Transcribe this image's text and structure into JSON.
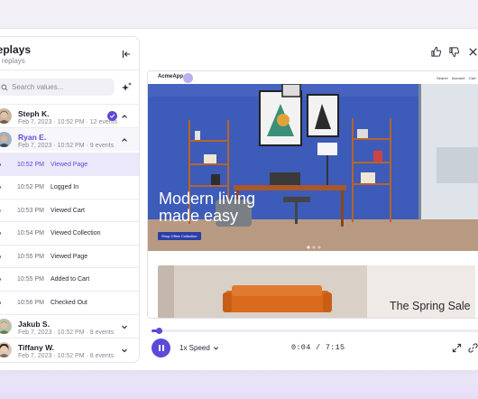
{
  "sidebar": {
    "title": "Replays",
    "subtitle": "replays",
    "search_placeholder": "Search values...",
    "users": [
      {
        "name": "Steph K.",
        "meta": "Feb 7, 2023 · 10:52 PM · 12 events",
        "expanded": true,
        "checked": true
      },
      {
        "name": "Ryan E.",
        "meta": "Feb 7, 2023 · 10:52 PM · 9 events",
        "expanded": true,
        "active": true
      },
      {
        "name": "Jakub S.",
        "meta": "Feb 7, 2023 · 10:52 PM · 8 events",
        "expanded": false
      },
      {
        "name": "Tiffany W.",
        "meta": "Feb 7, 2023 · 10:52 PM · 8 events",
        "expanded": false
      }
    ],
    "events": [
      {
        "time": "10:52 PM",
        "name": "Viewed Page",
        "selected": true
      },
      {
        "time": "10:52 PM",
        "name": "Logged In"
      },
      {
        "time": "10:53 PM",
        "name": "Viewed Cart"
      },
      {
        "time": "10:54 PM",
        "name": "Viewed Collection"
      },
      {
        "time": "10:55 PM",
        "name": "Viewed Page"
      },
      {
        "time": "10:55 PM",
        "name": "Added to Cart"
      },
      {
        "time": "10:56 PM",
        "name": "Checked Out"
      }
    ]
  },
  "preview": {
    "site_logo": "AcmeApp",
    "nav_links": [
      "Search",
      "Account",
      "Cart"
    ],
    "hero_title_line1": "Modern living",
    "hero_title_line2": "made easy",
    "hero_button": "Shop Office Collection",
    "promo_text": "The Spring Sale"
  },
  "player": {
    "speed_label": "1x Speed",
    "current_time": "0:04",
    "total_time": "7:15",
    "time_separator": "/",
    "progress": 0.01
  },
  "colors": {
    "accent": "#5b4bd6",
    "wall_blue": "#3d5bb8",
    "sofa_orange": "#d96a1e"
  }
}
